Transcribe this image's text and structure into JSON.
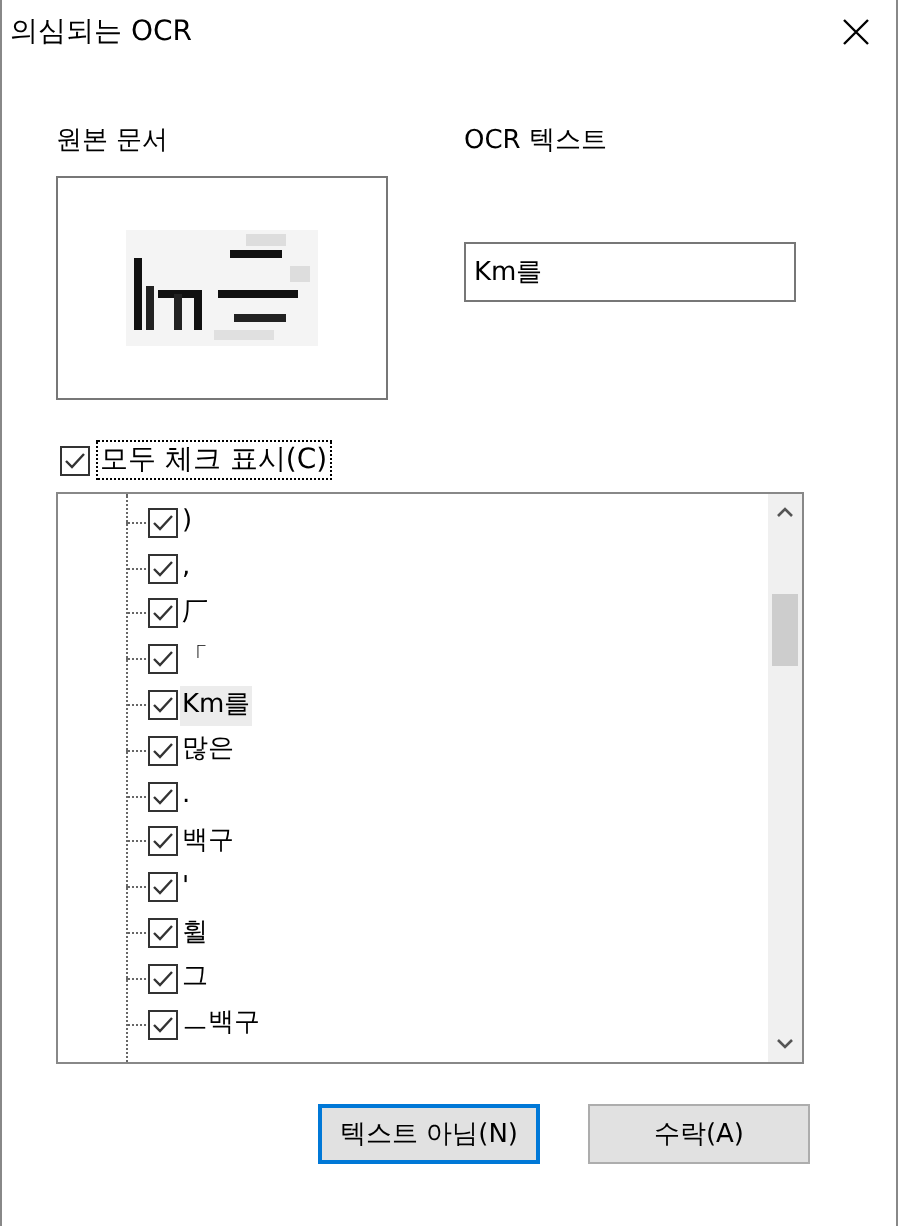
{
  "window": {
    "title": "의심되는 OCR"
  },
  "source": {
    "label": "원본 문서"
  },
  "ocr": {
    "label": "OCR 텍스트",
    "value": "Km를"
  },
  "check_all": {
    "label": "모두 체크 표시(C)",
    "checked": true
  },
  "items": [
    {
      "text": ")",
      "checked": true,
      "selected": false
    },
    {
      "text": ",",
      "checked": true,
      "selected": false
    },
    {
      "text": "厂",
      "checked": true,
      "selected": false
    },
    {
      "text": "「",
      "checked": true,
      "selected": false
    },
    {
      "text": "Km를",
      "checked": true,
      "selected": true
    },
    {
      "text": "많은",
      "checked": true,
      "selected": false
    },
    {
      "text": ".",
      "checked": true,
      "selected": false
    },
    {
      "text": "백구",
      "checked": true,
      "selected": false
    },
    {
      "text": "'",
      "checked": true,
      "selected": false
    },
    {
      "text": "휠",
      "checked": true,
      "selected": false
    },
    {
      "text": "그",
      "checked": true,
      "selected": false
    },
    {
      "text": "ㅡ백구",
      "checked": true,
      "selected": false
    }
  ],
  "buttons": [
    {
      "label": "텍스트 아님(N)",
      "selected": true
    },
    {
      "label": "수락(A)",
      "selected": false
    }
  ]
}
